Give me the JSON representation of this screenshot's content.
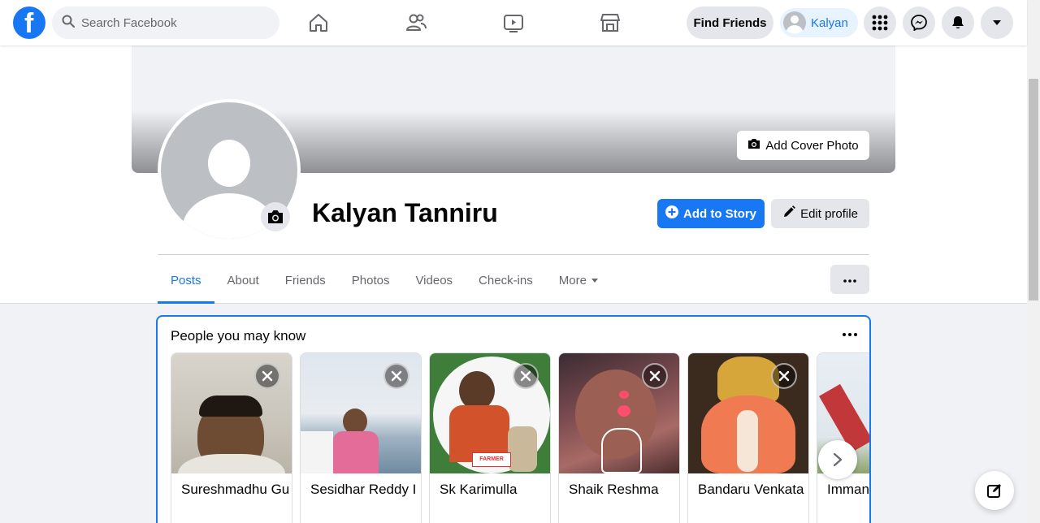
{
  "topbar": {
    "logo_letter": "f",
    "search_placeholder": "Search Facebook",
    "find_friends_label": "Find Friends",
    "profile_name": "Kalyan"
  },
  "profile": {
    "name": "Kalyan Tanniru",
    "add_cover_label": "Add Cover Photo",
    "add_story_label": "Add to Story",
    "edit_profile_label": "Edit profile"
  },
  "tabs": [
    {
      "label": "Posts",
      "active": true
    },
    {
      "label": "About"
    },
    {
      "label": "Friends"
    },
    {
      "label": "Photos"
    },
    {
      "label": "Videos"
    },
    {
      "label": "Check-ins"
    },
    {
      "label": "More"
    }
  ],
  "pymk": {
    "title": "People you may know",
    "people": [
      {
        "name": "Sureshmadhu Gu"
      },
      {
        "name": "Sesidhar Reddy I"
      },
      {
        "name": "Sk Karimulla"
      },
      {
        "name": "Shaik Reshma"
      },
      {
        "name": "Bandaru Venkata"
      },
      {
        "name": "Imman"
      }
    ]
  },
  "colors": {
    "brand": "#1877f2",
    "button_gray": "#e4e6eb",
    "page_bg": "#f0f2f5"
  }
}
